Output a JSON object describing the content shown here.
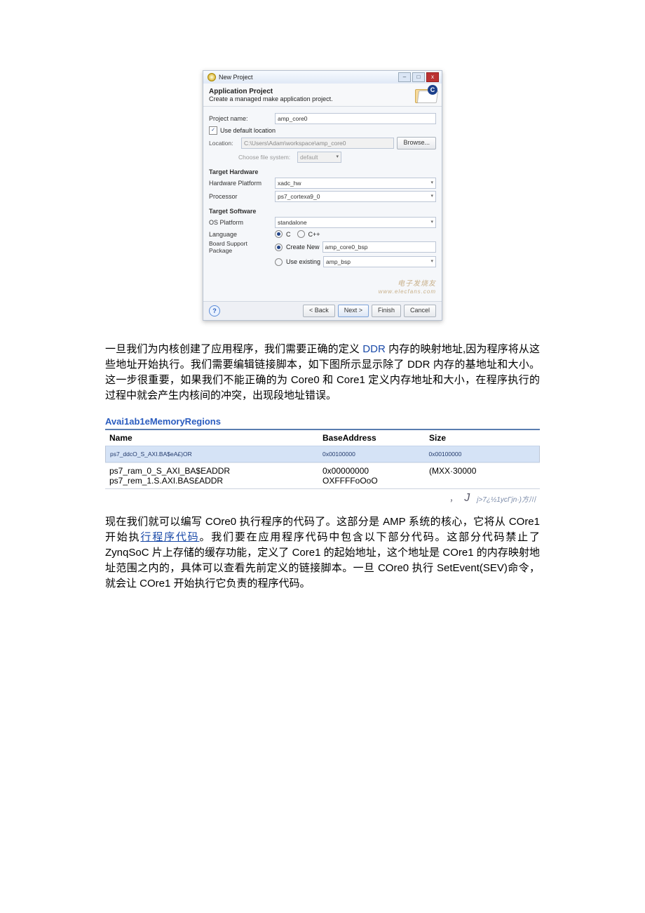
{
  "dialog": {
    "title": "New Project",
    "header_title": "Application Project",
    "header_sub": "Create a managed make application project.",
    "folder_c": "C",
    "proj_name_lbl": "Project name:",
    "proj_name_val": "amp_core0",
    "use_default_loc": "Use default location",
    "location_lbl": "Location:",
    "location_val": "C:\\Users\\Adam\\workspace\\amp_core0",
    "browse": "Browse...",
    "choose_fs_lbl": "Choose file system:",
    "choose_fs_val": "default",
    "target_hw": "Target Hardware",
    "hw_platform_lbl": "Hardware Platform",
    "hw_platform_val": "xadc_hw",
    "processor_lbl": "Processor",
    "processor_val": "ps7_cortexa9_0",
    "target_sw": "Target Software",
    "os_platform_lbl": "OS Platform",
    "os_platform_val": "standalone",
    "language_lbl": "Language",
    "lang_c": "C",
    "lang_cpp": "C++",
    "bsp_lbl": "Board Support Package",
    "bsp_create": "Create New",
    "bsp_create_val": "amp_core0_bsp",
    "bsp_existing": "Use existing",
    "bsp_existing_val": "amp_bsp",
    "watermark": "电子发烧友",
    "watermark2": "www.elecfans.com",
    "help": "?",
    "btn_back": "< Back",
    "btn_next": "Next >",
    "btn_finish": "Finish",
    "btn_cancel": "Cancel"
  },
  "para1_a": "一旦我们为内核创建了应用程序，我们需要正确的定义 ",
  "para1_ddr": "DDR",
  "para1_b": " 内存的映射地址,因为程序将从这些地址开始执行。我们需要编辑链接脚本，如下图所示显示除了 DDR 内存的基地址和大小。这一步很重要，如果我们不能正确的为 Core0 和 Core1 定义内存地址和大小，在程序执行的过程中就会产生内核间的冲突，出现段地址错误。",
  "mem": {
    "title": "Avai1ab1eMemoryRegions",
    "h_name": "Name",
    "h_base": "BaseAddress",
    "h_size": "Size",
    "rows": [
      {
        "name": "ps7_ddcO_S_AXI.BA$eA£)OR",
        "base": "0x00100000",
        "size": "0x00100000"
      },
      {
        "name": "ps7_ram_0_S_AXI_BA$EADDR",
        "base": "0x00000000",
        "size": "(MXX·30000"
      },
      {
        "name": "ps7_rem_1.S.AXI.BAS£ADDR",
        "base": "OXFFFFoOoO",
        "size": ""
      }
    ],
    "foot_comma": "，",
    "foot_plus": "J",
    "foot_gar": "j>7¿½1ycΓjn·)方川"
  },
  "para2_a": "现在我们就可以编写 COre0 执行程序的代码了。这部分是 AMP 系统的核心，它将从 COre1 开始执",
  "para2_link": "行程序代码",
  "para2_b": "。我们要在应用程序代码中包含以下部分代码。这部分代码禁止了 ZynqSoC 片上存储的缓存功能，定义了 Core1 的起始地址，这个地址是 COre1 的内存映射地址范围之内的，具体可以查看先前定义的链接脚本。一旦 COre0 执行 SetEvent(SEV)命令，就会让 COre1 开始执行它负责的程序代码。"
}
